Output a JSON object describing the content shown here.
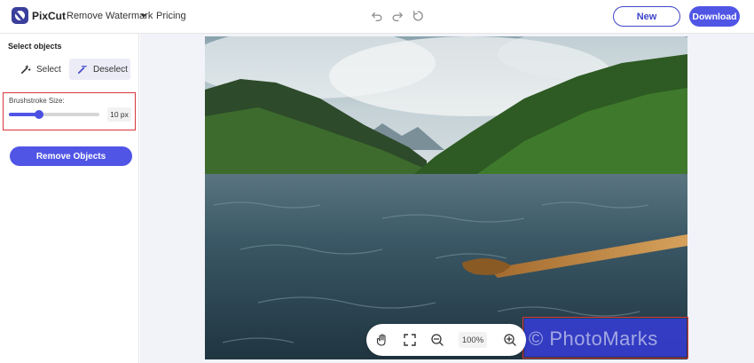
{
  "header": {
    "app_name": "PixCut",
    "nav_remove_watermark": "Remove Watermark",
    "nav_pricing": "Pricing",
    "new_label": "New",
    "download_label": "Download",
    "icons": [
      "undo-icon",
      "redo-icon",
      "reset-icon"
    ]
  },
  "sidebar": {
    "select_objects_title": "Select objects",
    "select_label": "Select",
    "deselect_label": "Deselect",
    "brushstroke_label": "Brushstroke Size:",
    "brush_value": "10 px",
    "brush_level": 0.33,
    "remove_objects_label": "Remove Objects"
  },
  "canvas": {
    "watermark_text": "© PhotoMarks",
    "zoom_value": "100%",
    "icons": [
      "hand-icon",
      "fit-screen-icon",
      "zoom-out-icon",
      "zoom-in-icon"
    ]
  },
  "colors": {
    "accent": "#5055e6",
    "highlight_border": "#d9353b"
  }
}
